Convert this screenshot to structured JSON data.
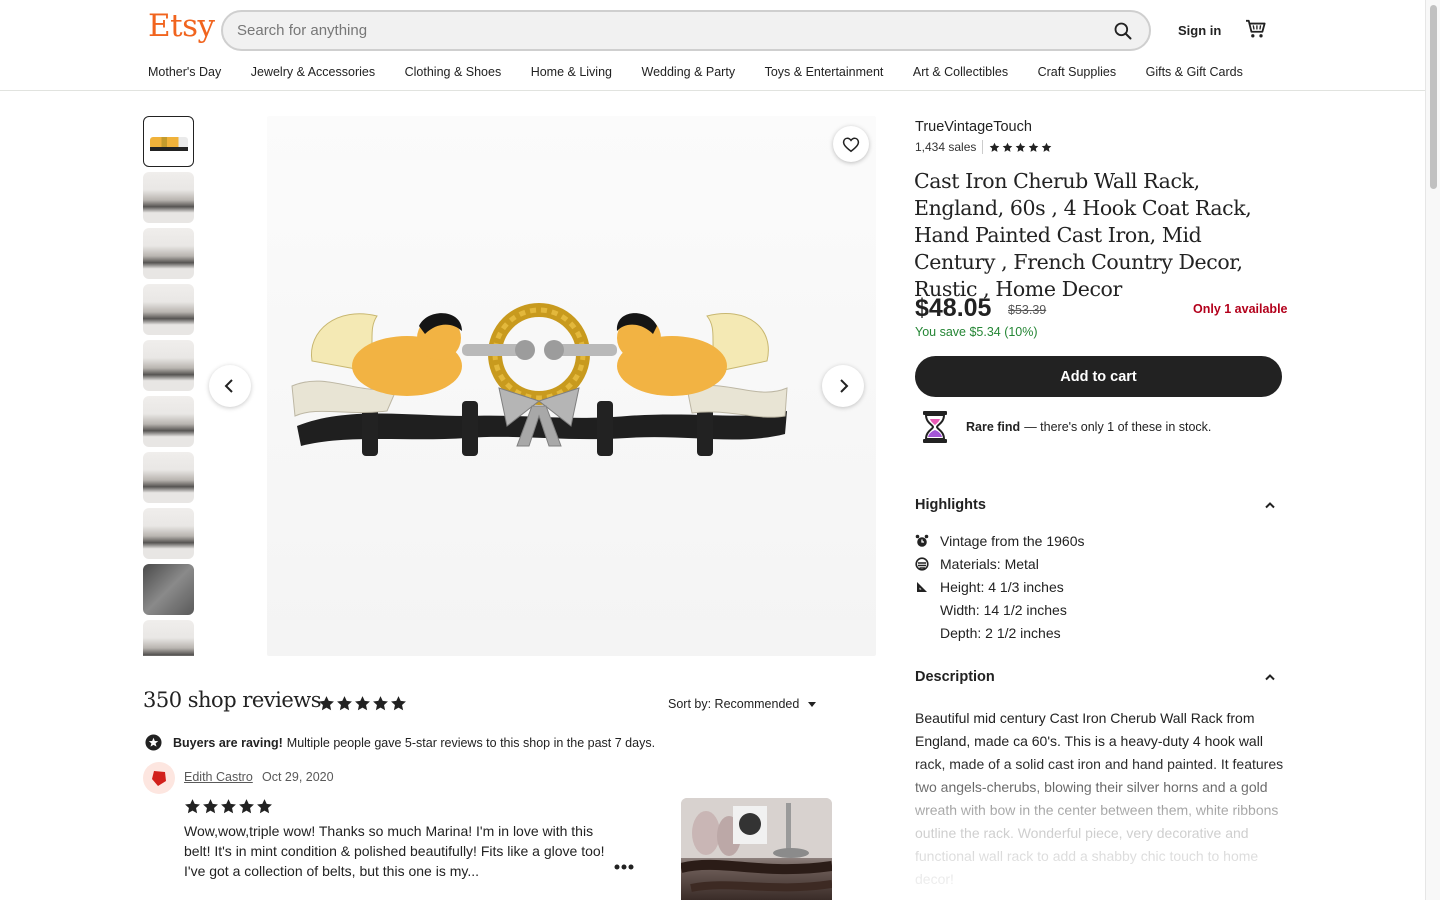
{
  "header": {
    "logo": "Etsy",
    "search_placeholder": "Search for anything",
    "signin": "Sign in"
  },
  "categories": [
    "Mother's Day",
    "Jewelry & Accessories",
    "Clothing & Shoes",
    "Home & Living",
    "Wedding & Party",
    "Toys & Entertainment",
    "Art & Collectibles",
    "Craft Supplies",
    "Gifts & Gift Cards"
  ],
  "gallery": {
    "thumbnail_count": 10,
    "active_index": 0
  },
  "shop": {
    "name": "TrueVintageTouch",
    "sales": "1,434 sales",
    "rating": 5
  },
  "listing": {
    "title": "Cast Iron Cherub Wall Rack, England, 60s , 4 Hook Coat Rack, Hand Painted Cast Iron, Mid Century , French Country Decor, Rustic , Home Decor",
    "price": "$48.05",
    "old_price": "$53.39",
    "availability": "Only 1 available",
    "savings": "You save $5.34 (10%)",
    "add_to_cart": "Add to cart",
    "rare_label": "Rare find",
    "rare_text": "— there's only 1 of these in stock."
  },
  "highlights": {
    "heading": "Highlights",
    "items": [
      {
        "icon": "alarm-clock-icon",
        "text": "Vintage from the 1960s"
      },
      {
        "icon": "materials-icon",
        "text": "Materials: Metal"
      },
      {
        "icon": "ruler-icon",
        "text": "Height: 4 1/3 inches"
      },
      {
        "icon": "",
        "text": "Width: 14 1/2 inches"
      },
      {
        "icon": "",
        "text": "Depth: 2 1/2 inches"
      }
    ]
  },
  "description": {
    "heading": "Description",
    "text": "Beautiful mid century Cast Iron Cherub Wall Rack from England, made ca 60's. This is a heavy-duty 4 hook wall rack, made of a solid cast iron and hand painted. It features two angels-cherubs, blowing their silver horns and a gold wreath with bow in the center between them, white ribbons outline the rack. Wonderful piece, very decorative and functional wall rack to add a shabby chic touch to home decor!"
  },
  "reviews": {
    "title": "350 shop reviews",
    "rating": 5,
    "sort_label": "Sort by: Recommended",
    "raving_bold": "Buyers are raving!",
    "raving_text": "Multiple people gave 5-star reviews to this shop in the past 7 days.",
    "items": [
      {
        "reviewer": "Edith Castro",
        "date": "Oct 29, 2020",
        "stars": 5,
        "text": "Wow,wow,triple wow! Thanks so much Marina! I'm in love with this belt! It's in mint condition & polished beautifully! Fits like a glove too! I've got a collection of belts, but this one is my..."
      }
    ]
  },
  "colors": {
    "brand": "#f1641e",
    "sale_green": "#258635",
    "alert_red": "#b3001b",
    "button_dark": "#222222"
  }
}
